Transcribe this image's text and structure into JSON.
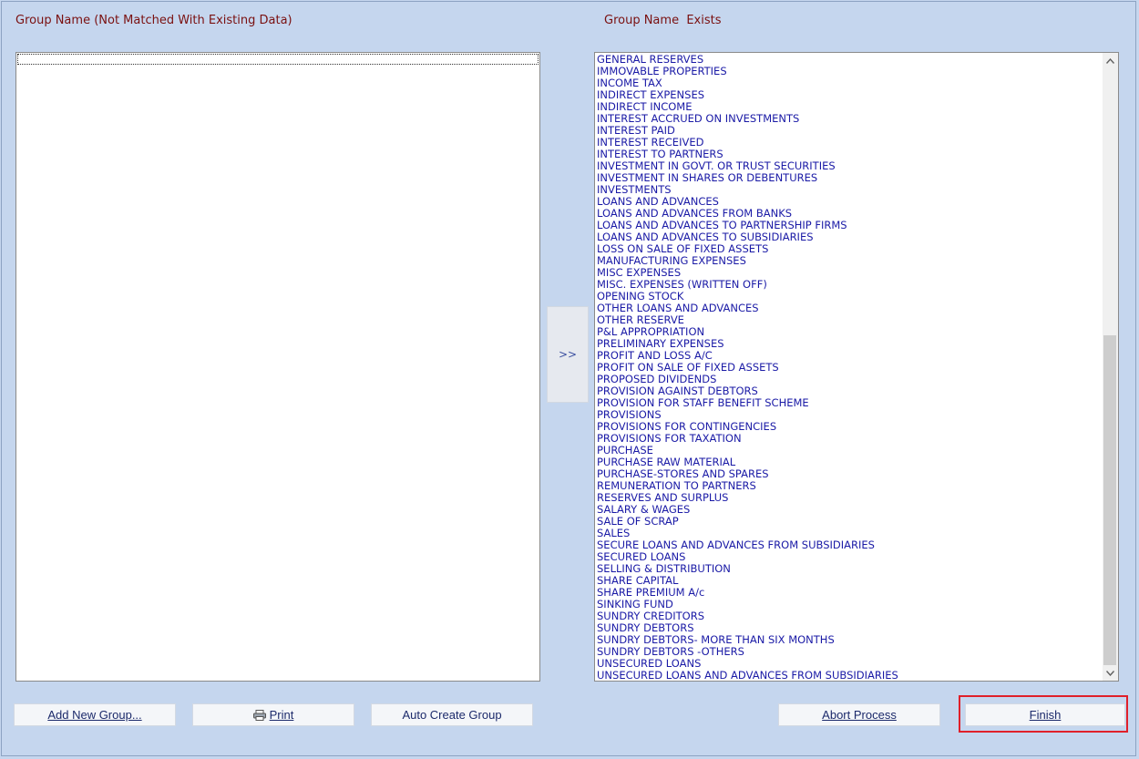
{
  "headings": {
    "left": "Group Name (Not Matched With Existing Data)",
    "right": "Group Name  Exists"
  },
  "move_button": ">>",
  "existing_groups": [
    "GENERAL RESERVES",
    "IMMOVABLE PROPERTIES",
    "INCOME TAX",
    "INDIRECT EXPENSES",
    "INDIRECT INCOME",
    "INTEREST ACCRUED ON INVESTMENTS",
    "INTEREST PAID",
    "INTEREST RECEIVED",
    "INTEREST TO PARTNERS",
    "INVESTMENT IN GOVT. OR TRUST SECURITIES",
    "INVESTMENT IN SHARES OR DEBENTURES",
    "INVESTMENTS",
    "LOANS AND ADVANCES",
    "LOANS AND ADVANCES FROM BANKS",
    "LOANS AND ADVANCES TO PARTNERSHIP FIRMS",
    "LOANS AND ADVANCES TO SUBSIDIARIES",
    "LOSS ON SALE OF FIXED ASSETS",
    "MANUFACTURING EXPENSES",
    "MISC EXPENSES",
    "MISC. EXPENSES (WRITTEN OFF)",
    "OPENING STOCK",
    "OTHER LOANS AND ADVANCES",
    "OTHER RESERVE",
    "P&L APPROPRIATION",
    "PRELIMINARY EXPENSES",
    "PROFIT AND LOSS A/C",
    "PROFIT ON SALE OF FIXED ASSETS",
    "PROPOSED DIVIDENDS",
    "PROVISION AGAINST DEBTORS",
    "PROVISION FOR STAFF BENEFIT SCHEME",
    "PROVISIONS",
    "PROVISIONS FOR CONTINGENCIES",
    "PROVISIONS FOR TAXATION",
    "PURCHASE",
    "PURCHASE RAW MATERIAL",
    "PURCHASE-STORES AND SPARES",
    "REMUNERATION TO PARTNERS",
    "RESERVES AND SURPLUS",
    "SALARY & WAGES",
    "SALE OF SCRAP",
    "SALES",
    "SECURE LOANS AND ADVANCES FROM SUBSIDIARIES",
    "SECURED LOANS",
    "SELLING & DISTRIBUTION",
    "SHARE CAPITAL",
    "SHARE PREMIUM A/c",
    "SINKING FUND",
    "SUNDRY CREDITORS",
    "SUNDRY DEBTORS",
    "SUNDRY DEBTORS- MORE THAN SIX MONTHS",
    "SUNDRY DEBTORS -OTHERS",
    "UNSECURED LOANS",
    "UNSECURED LOANS AND ADVANCES FROM SUBSIDIARIES"
  ],
  "buttons": {
    "add_new_group": "Add New Group...",
    "print": "Print",
    "auto_create_group": "Auto Create Group",
    "abort_process": "Abort Process",
    "finish": "Finish"
  },
  "icons": {
    "print": "printer-icon",
    "scroll_up": "chevron-up-icon",
    "scroll_down": "chevron-down-icon"
  },
  "colors": {
    "background": "#c5d6ee",
    "heading": "#7a1010",
    "list_text": "#1a1aa6",
    "highlight": "#e0202a"
  }
}
